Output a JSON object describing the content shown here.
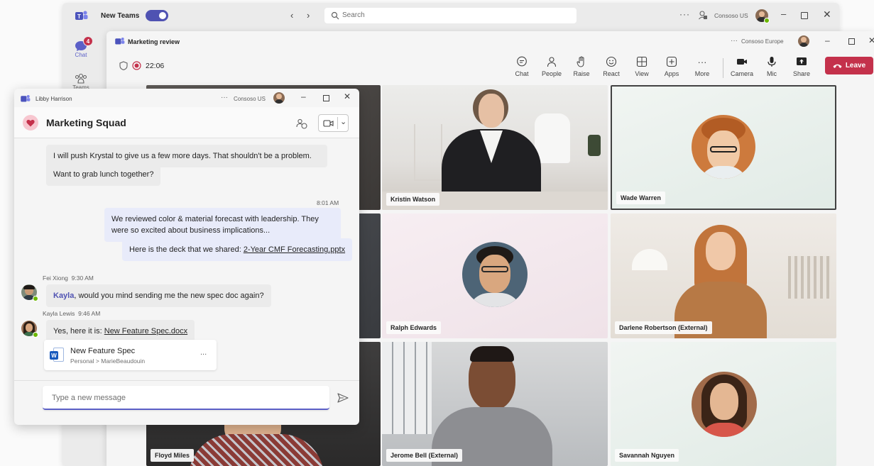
{
  "main_window": {
    "app_name": "New Teams",
    "search_placeholder": "Search",
    "org": "Consoso US",
    "rail": [
      {
        "label": "Chat",
        "badge": "4"
      },
      {
        "label": "Teams"
      }
    ]
  },
  "meeting": {
    "title": "Marketing review",
    "timer": "22:06",
    "org": "Consoso Europe",
    "toolbar": [
      "Chat",
      "People",
      "Raise",
      "React",
      "View",
      "Apps",
      "More",
      "Camera",
      "Mic",
      "Share"
    ],
    "leave_label": "Leave",
    "participants": [
      {
        "name": "Kristin Watson"
      },
      {
        "name": "Wade Warren"
      },
      {
        "name": "Ralph Edwards"
      },
      {
        "name": "Darlene Robertson (External)"
      },
      {
        "name": "Floyd Miles"
      },
      {
        "name": "Jerome Bell (External)"
      },
      {
        "name": "Savannah Nguyen"
      }
    ]
  },
  "chat_window": {
    "user": "Libby Harrison",
    "org": "Consoso US",
    "chat_name": "Marketing Squad",
    "messages": [
      {
        "text": "I will push Krystal to give us a few more days. That shouldn't be a problem."
      },
      {
        "text": "Want to grab lunch together?"
      }
    ],
    "my_time": "8:01 AM",
    "my_messages": [
      {
        "text": "We reviewed color & material forecast with leadership. They were so excited about business implications..."
      },
      {
        "text_prefix": "Here is the deck that we shared: ",
        "link": "2-Year CMF Forecasting.pptx"
      }
    ],
    "fei": {
      "sender": "Fei Xiong",
      "time": "9:30 AM",
      "mention": "Kayla",
      "text": ", would you mind sending me the new spec doc again?"
    },
    "kayla": {
      "sender": "Kayla Lewis",
      "time": "9:46 AM",
      "text_prefix": "Yes, here it is: ",
      "link": "New Feature Spec.docx"
    },
    "file_card": {
      "title": "New Feature Spec",
      "path": "Personal > MarieBeaudouin",
      "more": "..."
    },
    "compose_placeholder": "Type a new message"
  }
}
